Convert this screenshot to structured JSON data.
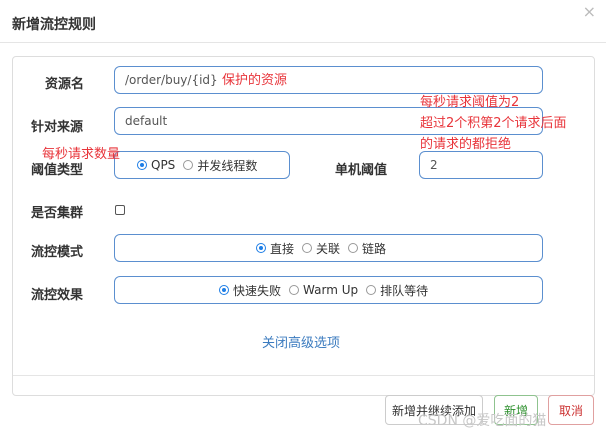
{
  "dialog": {
    "title": "新增流控规则",
    "close_symbol": "×"
  },
  "form": {
    "resource": {
      "label": "资源名",
      "value": "/order/buy/{id}"
    },
    "limit_app": {
      "label": "针对来源",
      "value": "default"
    },
    "grade": {
      "label": "阈值类型",
      "options": [
        {
          "label": "QPS",
          "checked": true
        },
        {
          "label": "并发线程数",
          "checked": false
        }
      ]
    },
    "threshold": {
      "label": "单机阈值",
      "value": "2"
    },
    "cluster": {
      "label": "是否集群",
      "checked": false
    },
    "strategy": {
      "label": "流控模式",
      "options": [
        {
          "label": "直接",
          "checked": true
        },
        {
          "label": "关联",
          "checked": false
        },
        {
          "label": "链路",
          "checked": false
        }
      ]
    },
    "effect": {
      "label": "流控效果",
      "options": [
        {
          "label": "快速失败",
          "checked": true
        },
        {
          "label": "Warm Up",
          "checked": false
        },
        {
          "label": "排队等待",
          "checked": false
        }
      ]
    },
    "advanced_link": "关闭高级选项"
  },
  "buttons": {
    "save_and_continue": "新增并继续添加",
    "save": "新增",
    "cancel": "取消"
  },
  "annotations": {
    "resource_note": "保护的资源",
    "threshold_note_line1": "每秒请求阈值为2",
    "threshold_note_line2": "超过2个积第2个请求后面",
    "threshold_note_line3": "的请求的都拒绝",
    "qps_note": "每秒请求数量"
  },
  "watermark": "CSDN @爱吃面的猫",
  "colors": {
    "accent": "#1e7ee6",
    "input_border": "#5b8fcf",
    "annotation": "#e8343a",
    "save_button": "#2b8f2b",
    "cancel_button": "#cc3333",
    "link": "#3b7bbf"
  }
}
